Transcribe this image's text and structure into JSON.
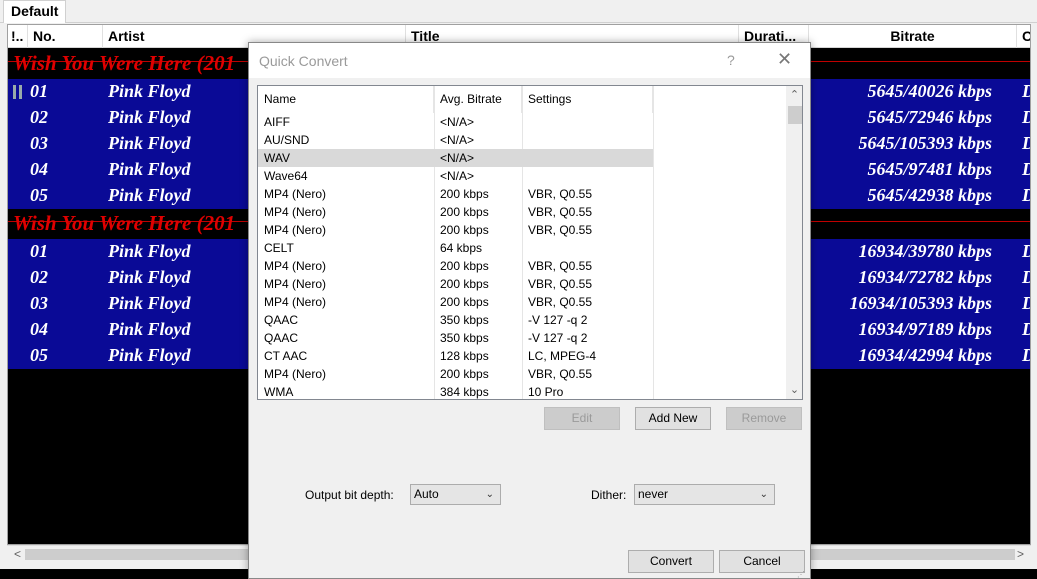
{
  "tabs": {
    "active": "Default"
  },
  "playlist": {
    "columns": [
      "!..",
      "No.",
      "Artist",
      "Title",
      "Durati...",
      "Bitrate",
      "C"
    ],
    "groups": [
      {
        "title": "Wish You Were Here (201",
        "rows": [
          {
            "no": "01",
            "artist": "Pink Floyd",
            "bitrate": "5645/40026 kbps",
            "extra": "D"
          },
          {
            "no": "02",
            "artist": "Pink Floyd",
            "bitrate": "5645/72946 kbps",
            "extra": "D"
          },
          {
            "no": "03",
            "artist": "Pink Floyd",
            "bitrate": "5645/105393 kbps",
            "extra": "D"
          },
          {
            "no": "04",
            "artist": "Pink Floyd",
            "bitrate": "5645/97481 kbps",
            "extra": "D"
          },
          {
            "no": "05",
            "artist": "Pink Floyd",
            "bitrate": "5645/42938 kbps",
            "extra": "D"
          }
        ]
      },
      {
        "title": "Wish You Were Here (201",
        "rows": [
          {
            "no": "01",
            "artist": "Pink Floyd",
            "bitrate": "16934/39780 kbps",
            "extra": "D"
          },
          {
            "no": "02",
            "artist": "Pink Floyd",
            "bitrate": "16934/72782 kbps",
            "extra": "D"
          },
          {
            "no": "03",
            "artist": "Pink Floyd",
            "bitrate": "16934/105393 kbps",
            "extra": "D"
          },
          {
            "no": "04",
            "artist": "Pink Floyd",
            "bitrate": "16934/97189 kbps",
            "extra": "D"
          },
          {
            "no": "05",
            "artist": "Pink Floyd",
            "bitrate": "16934/42994 kbps",
            "extra": "D"
          }
        ]
      }
    ],
    "scroll_left": "<",
    "scroll_right": ">"
  },
  "dialog": {
    "title": "Quick Convert",
    "help": "?",
    "close": "✕",
    "columns": {
      "name": "Name",
      "bitrate": "Avg. Bitrate",
      "settings": "Settings"
    },
    "items": [
      {
        "name": "AIFF",
        "bitrate": "<N/A>",
        "settings": ""
      },
      {
        "name": "AU/SND",
        "bitrate": "<N/A>",
        "settings": ""
      },
      {
        "name": "WAV",
        "bitrate": "<N/A>",
        "settings": "",
        "selected": true
      },
      {
        "name": "Wave64",
        "bitrate": "<N/A>",
        "settings": ""
      },
      {
        "name": "MP4 (Nero)",
        "bitrate": "200 kbps",
        "settings": "VBR, Q0.55"
      },
      {
        "name": "MP4 (Nero)",
        "bitrate": "200 kbps",
        "settings": "VBR, Q0.55"
      },
      {
        "name": "MP4 (Nero)",
        "bitrate": "200 kbps",
        "settings": "VBR, Q0.55"
      },
      {
        "name": "CELT",
        "bitrate": "64 kbps",
        "settings": ""
      },
      {
        "name": "MP4 (Nero)",
        "bitrate": "200 kbps",
        "settings": "VBR, Q0.55"
      },
      {
        "name": "MP4 (Nero)",
        "bitrate": "200 kbps",
        "settings": "VBR, Q0.55"
      },
      {
        "name": "MP4 (Nero)",
        "bitrate": "200 kbps",
        "settings": "VBR, Q0.55"
      },
      {
        "name": "QAAC",
        "bitrate": "350 kbps",
        "settings": "-V 127 -q 2"
      },
      {
        "name": "QAAC",
        "bitrate": "350 kbps",
        "settings": "-V 127 -q 2"
      },
      {
        "name": "CT AAC",
        "bitrate": "128 kbps",
        "settings": "LC, MPEG-4"
      },
      {
        "name": "MP4 (Nero)",
        "bitrate": "200 kbps",
        "settings": "VBR, Q0.55"
      },
      {
        "name": "WMA",
        "bitrate": "384 kbps",
        "settings": "10 Pro"
      }
    ],
    "buttons": {
      "edit": "Edit",
      "add_new": "Add New",
      "remove": "Remove",
      "convert": "Convert",
      "cancel": "Cancel"
    },
    "output_bit_depth": {
      "label": "Output bit depth:",
      "value": "Auto"
    },
    "dither": {
      "label": "Dither:",
      "value": "never"
    }
  }
}
